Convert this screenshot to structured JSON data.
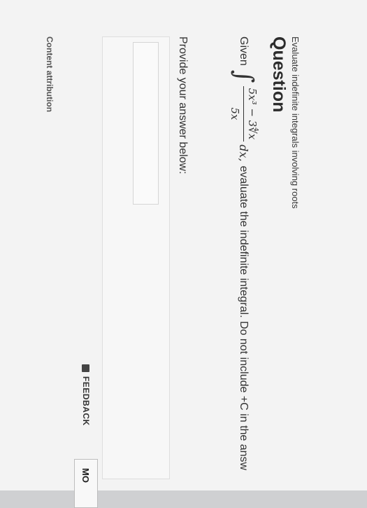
{
  "question": {
    "breadcrumb": "Evaluate indefinite integrals involving roots",
    "heading": "Question",
    "given": "Given",
    "integral_sign": "∫",
    "numerator": "5x³ − 3∜x",
    "denominator": "5x",
    "differential": "dx,",
    "instruction": "evaluate the indefinite integral. Do not include +C in the answ"
  },
  "answer": {
    "label": "Provide your answer below:"
  },
  "footer": {
    "attribution": "Content attribution",
    "feedback": "FEEDBACK",
    "more": "MO"
  }
}
